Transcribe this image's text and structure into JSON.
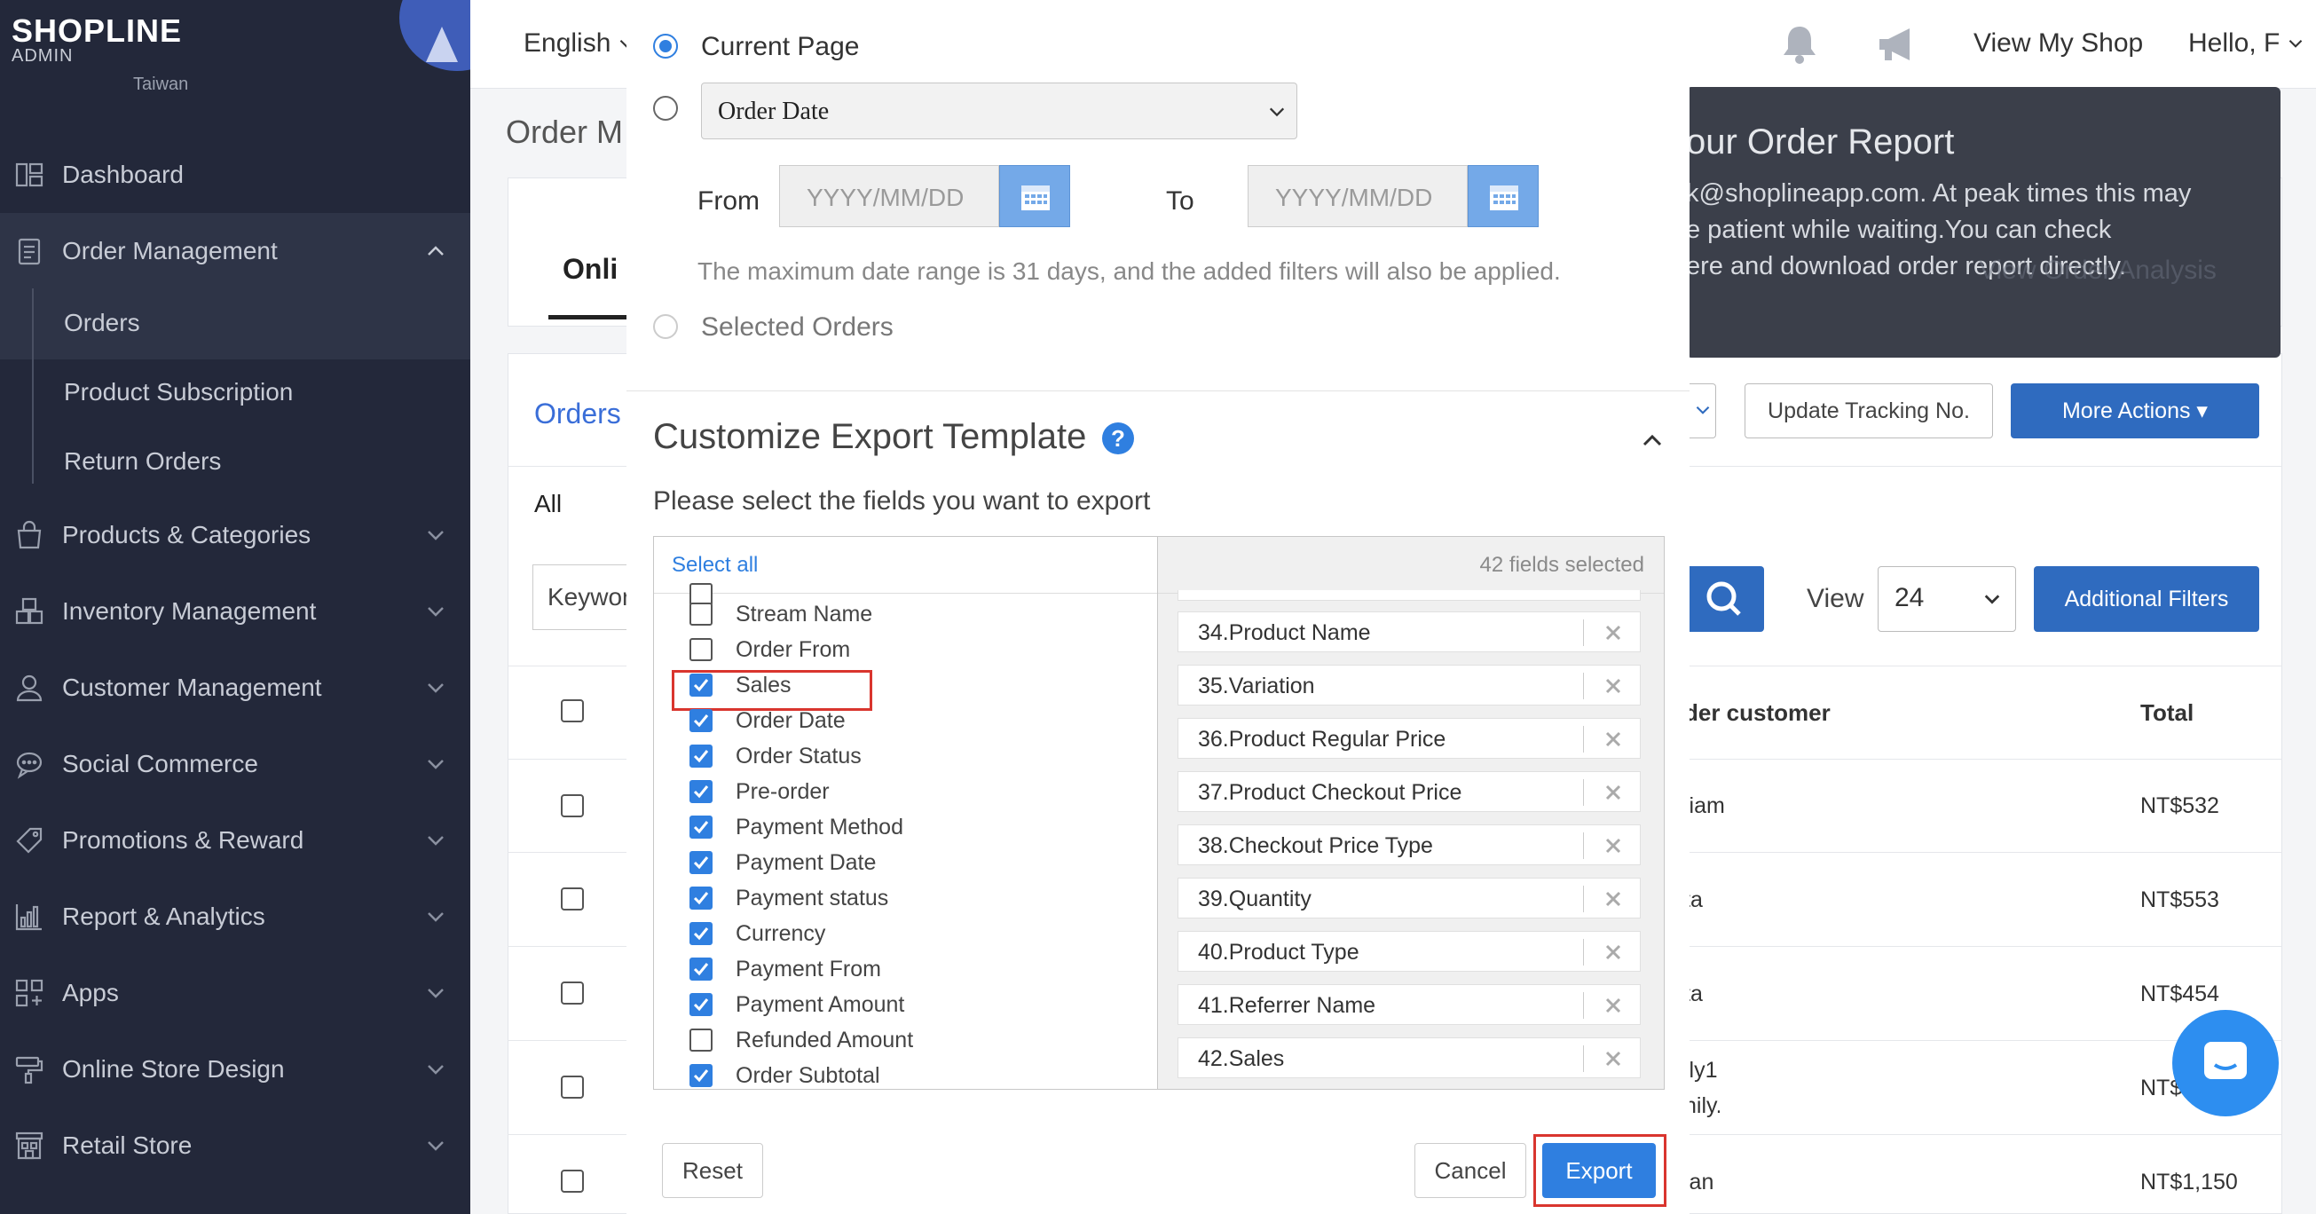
{
  "sidebar": {
    "brand": "SHOPLINE",
    "brand_sub": "ADMIN",
    "store_region": "Taiwan",
    "items": [
      {
        "label": "Dashboard",
        "icon": "dashboard-icon"
      },
      {
        "label": "Order Management",
        "icon": "clipboard-icon"
      },
      {
        "label": "Products & Categories",
        "icon": "bag-icon"
      },
      {
        "label": "Inventory Management",
        "icon": "boxes-icon"
      },
      {
        "label": "Customer Management",
        "icon": "person-icon"
      },
      {
        "label": "Social Commerce",
        "icon": "chat-bubble-icon"
      },
      {
        "label": "Promotions & Reward",
        "icon": "tag-icon"
      },
      {
        "label": "Report & Analytics",
        "icon": "bar-chart-icon"
      },
      {
        "label": "Apps",
        "icon": "apps-grid-icon"
      },
      {
        "label": "Online Store Design",
        "icon": "paint-roller-icon"
      },
      {
        "label": "Retail Store",
        "icon": "store-icon"
      }
    ],
    "order_sub": [
      "Orders",
      "Product Subscription",
      "Return Orders"
    ]
  },
  "topbar": {
    "language": "English",
    "view_shop": "View My Shop",
    "greeting": "Hello, F"
  },
  "page": {
    "title": "Order M",
    "tab_online": "Onli",
    "orders_label": "Orders",
    "tab_all": "All",
    "keyword_placeholder": "Keywor",
    "update_tracking": "Update Tracking No.",
    "more_actions": "More Actions ▾",
    "view_label": "View",
    "view_value": "24",
    "additional_filters": "Additional Filters",
    "col_customer": "der customer",
    "col_total": "Total",
    "rows": [
      {
        "customer": "liam",
        "total": "NT$532"
      },
      {
        "customer": "ta",
        "total": "NT$553"
      },
      {
        "customer": "ta",
        "total": "NT$454"
      },
      {
        "customer": "ily1",
        "customer2": "nily.",
        "total": "NT$"
      },
      {
        "customer": "ian",
        "total": "NT$1,150"
      }
    ]
  },
  "notification": {
    "title": "our Order Report",
    "lines": [
      "k@shoplineapp.com. At peak times this may",
      "e patient while waiting.You can check",
      "ere and download order report directly."
    ],
    "link_fragment": "ere",
    "behind_link": "View Order Analysis"
  },
  "modal": {
    "current_page": "Current Page",
    "order_date_select": "Order Date",
    "from_label": "From",
    "to_label": "To",
    "date_placeholder": "YYYY/MM/DD",
    "hint": "The maximum date range is 31 days, and the added filters will also be applied.",
    "selected_orders": "Selected Orders",
    "section_title": "Customize Export Template",
    "prompt": "Please select the fields you want to export",
    "select_all": "Select all",
    "fields_selected": "42 fields selected",
    "available_fields": [
      {
        "label": "Stream Name",
        "checked": false
      },
      {
        "label": "Order From",
        "checked": false
      },
      {
        "label": "Sales",
        "checked": true
      },
      {
        "label": "Order Date",
        "checked": true
      },
      {
        "label": "Order Status",
        "checked": true
      },
      {
        "label": "Pre-order",
        "checked": true
      },
      {
        "label": "Payment Method",
        "checked": true
      },
      {
        "label": "Payment Date",
        "checked": true
      },
      {
        "label": "Payment status",
        "checked": true
      },
      {
        "label": "Currency",
        "checked": true
      },
      {
        "label": "Payment From",
        "checked": true
      },
      {
        "label": "Payment Amount",
        "checked": true
      },
      {
        "label": "Refunded Amount",
        "checked": false
      },
      {
        "label": "Order Subtotal",
        "checked": true
      }
    ],
    "selected_fields": [
      "34.Product Name",
      "35.Variation",
      "36.Product Regular Price",
      "37.Product Checkout Price",
      "38.Checkout Price Type",
      "39.Quantity",
      "40.Product Type",
      "41.Referrer Name",
      "42.Sales"
    ],
    "reset": "Reset",
    "cancel": "Cancel",
    "export": "Export"
  }
}
